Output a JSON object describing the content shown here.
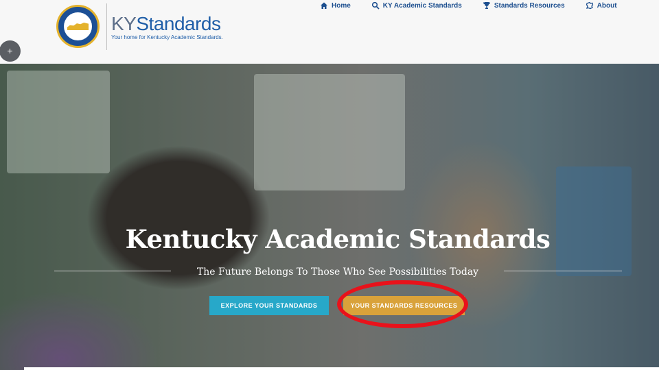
{
  "header": {
    "brand_ky": "KY",
    "brand_standards": "Standards",
    "tagline": "Your home for Kentucky Academic Standards.",
    "seal_name": "Kentucky Department of Education"
  },
  "nav": {
    "items": [
      {
        "label": "Home",
        "icon": "home-icon"
      },
      {
        "label": "KY Academic Standards",
        "icon": "search-icon"
      },
      {
        "label": "Standards Resources",
        "icon": "trophy-icon"
      },
      {
        "label": "About",
        "icon": "kentucky-map-icon"
      }
    ]
  },
  "hero": {
    "title": "Kentucky Academic Standards",
    "subtitle": "The Future Belongs To Those Who See Possibilities Today",
    "explore_label": "EXPLORE YOUR STANDARDS",
    "resources_label": "YOUR STANDARDS RESOURCES"
  },
  "floating": {
    "plus_label": "+"
  },
  "colors": {
    "nav_text": "#1d4f8f",
    "explore_button": "#27a8c9",
    "resources_button": "#d9a23a",
    "highlight_circle": "#e8121b"
  }
}
